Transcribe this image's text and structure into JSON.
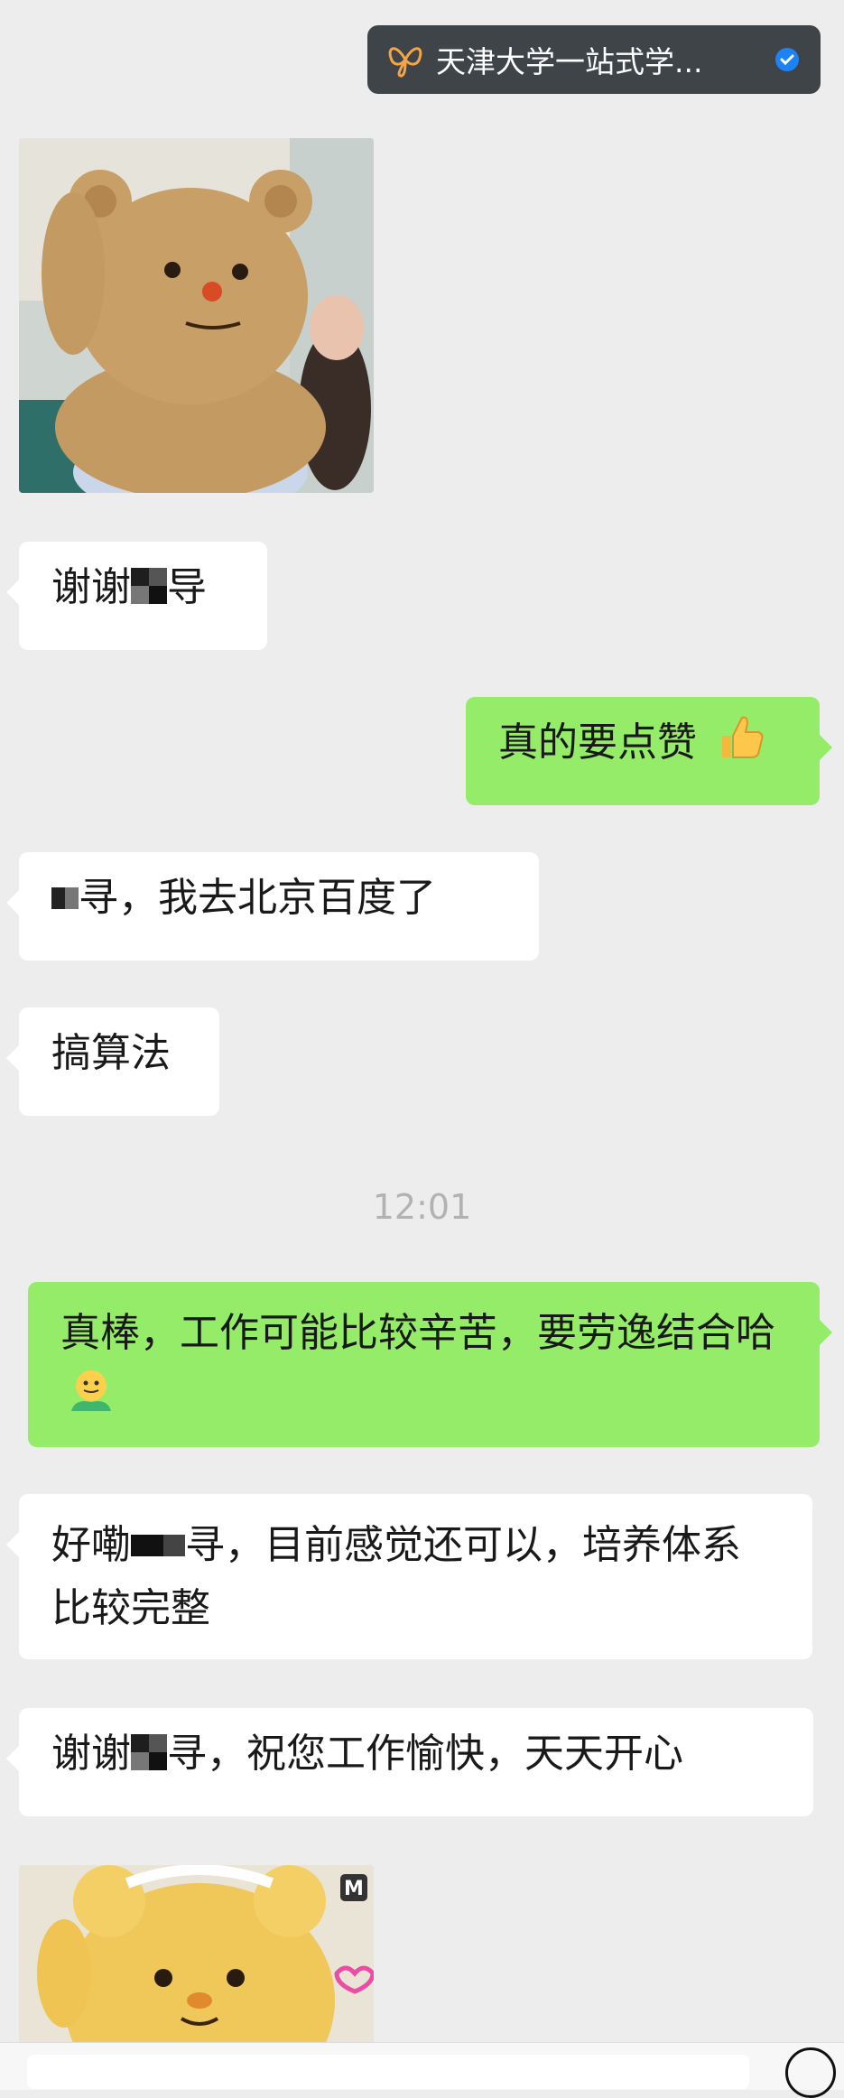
{
  "official_account": {
    "name": "天津大学一站式学...",
    "logo_icon": "butterfly-logo-icon",
    "verified_icon": "verified-check-icon"
  },
  "messages": [
    {
      "type": "image",
      "from": "incoming",
      "content": "bear-mascot-sticker"
    },
    {
      "type": "text",
      "from": "incoming",
      "prefix": "谢谢",
      "suffix": "导"
    },
    {
      "type": "text",
      "from": "outgoing",
      "text": "真的要点赞",
      "emoji": "thumbs-up-icon"
    },
    {
      "type": "text",
      "from": "incoming",
      "text": "寻，我去北京百度了"
    },
    {
      "type": "text",
      "from": "incoming",
      "text": "搞算法"
    },
    {
      "type": "time",
      "text": "12:01"
    },
    {
      "type": "text",
      "from": "outgoing",
      "text": "真棒，工作可能比较辛苦，要劳逸结合哈",
      "emoji": "smiley-hug-icon"
    },
    {
      "type": "text",
      "from": "incoming",
      "prefix": "好嘞",
      "suffix": "寻，目前感觉还可以，培养体系比较完整"
    },
    {
      "type": "text",
      "from": "incoming",
      "prefix": "谢谢",
      "suffix": "寻，祝您工作愉快，天天开心"
    },
    {
      "type": "image",
      "from": "incoming",
      "content": "yellow-bear-sticker"
    }
  ],
  "colors": {
    "background": "#ededed",
    "incoming_bubble": "#ffffff",
    "outgoing_bubble": "#95ec69",
    "timestamp": "#b2b2b2"
  }
}
